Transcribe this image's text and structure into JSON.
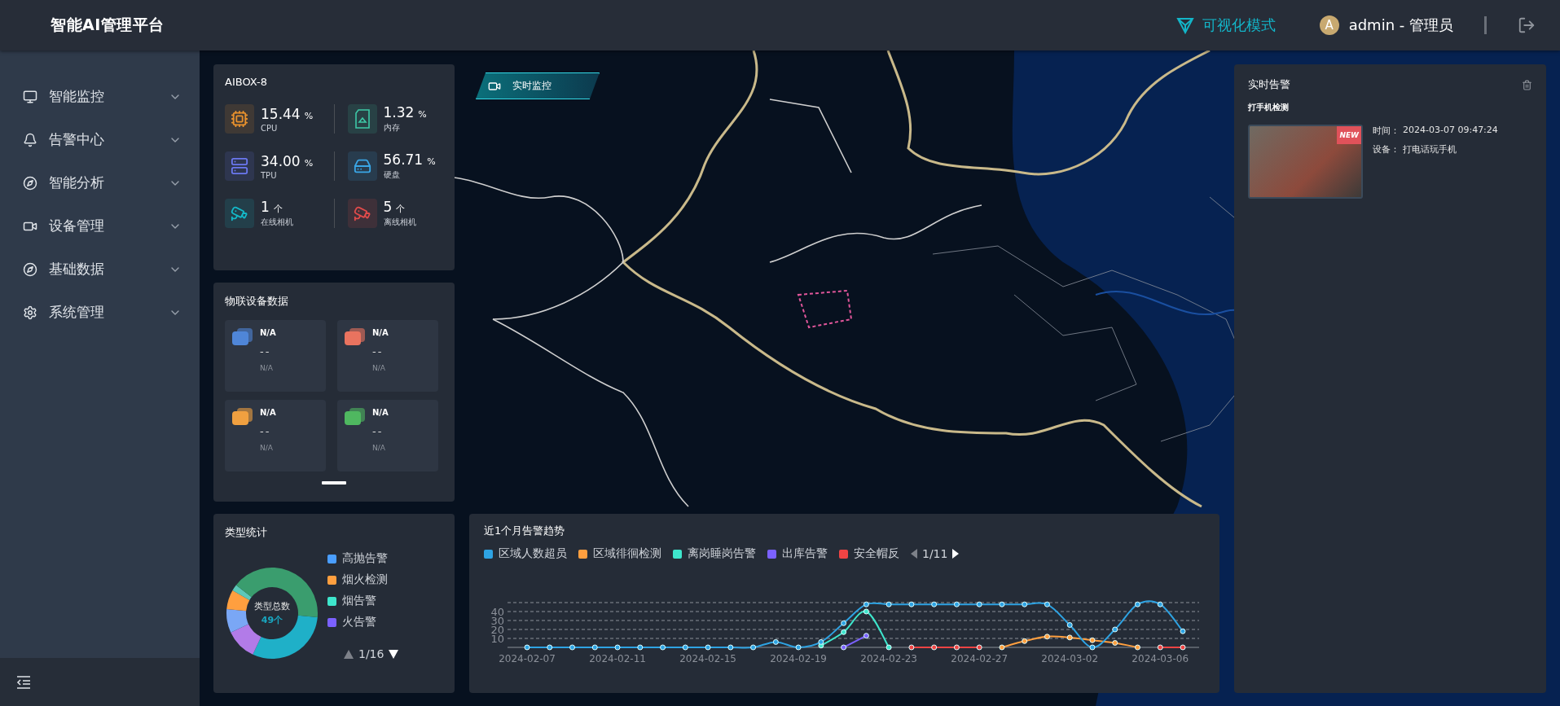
{
  "header": {
    "title": "智能AI管理平台",
    "mode_label": "可视化模式",
    "avatar_letter": "A",
    "user": "admin - 管理员"
  },
  "sidebar": {
    "items": [
      {
        "label": "智能监控",
        "expanded": false
      },
      {
        "label": "告警中心",
        "expanded": false
      },
      {
        "label": "智能分析",
        "expanded": false
      },
      {
        "label": "设备管理",
        "expanded": false
      },
      {
        "label": "基础数据",
        "expanded": false
      },
      {
        "label": "系统管理",
        "expanded": false
      }
    ]
  },
  "map_badge": "实时监控",
  "device": {
    "title": "AIBOX-8",
    "metrics": [
      {
        "value": "15.44",
        "unit": "%",
        "label": "CPU",
        "color": "#e8912d"
      },
      {
        "value": "1.32",
        "unit": "%",
        "label": "内存",
        "color": "#3ec9a7"
      },
      {
        "value": "34.00",
        "unit": "%",
        "label": "TPU",
        "color": "#6b78f0"
      },
      {
        "value": "56.71",
        "unit": "%",
        "label": "硬盘",
        "color": "#3aa6e6"
      },
      {
        "value": "1",
        "unit": "个",
        "label": "在线相机",
        "color": "#14b8c8"
      },
      {
        "value": "5",
        "unit": "个",
        "label": "离线相机",
        "color": "#e04b4b"
      }
    ]
  },
  "iot": {
    "title": "物联设备数据",
    "tiles": [
      {
        "name": "N/A",
        "value": "--",
        "sub": "N/A",
        "color": "#4f86d8"
      },
      {
        "name": "N/A",
        "value": "--",
        "sub": "N/A",
        "color": "#e9735f"
      },
      {
        "name": "N/A",
        "value": "--",
        "sub": "N/A",
        "color": "#f0a040"
      },
      {
        "name": "N/A",
        "value": "--",
        "sub": "N/A",
        "color": "#4fb860"
      }
    ]
  },
  "type_stats": {
    "title": "类型统计",
    "center_label": "类型总数",
    "center_value": "49个",
    "legend": [
      {
        "label": "高抛告警",
        "color": "#4a9eff"
      },
      {
        "label": "烟火检测",
        "color": "#ff9f3f"
      },
      {
        "label": "烟告警",
        "color": "#3ee6cc"
      },
      {
        "label": "火告警",
        "color": "#7b61ff"
      }
    ],
    "page": "1/16",
    "prev_disabled": true,
    "next_disabled": false
  },
  "trend": {
    "title": "近1个月告警趋势",
    "page": "1/11",
    "prev_disabled": true,
    "next_disabled": false,
    "chart_data": {
      "type": "line",
      "grid": true,
      "categories": [
        "2024-02-07",
        null,
        null,
        null,
        "2024-02-11",
        null,
        null,
        null,
        "2024-02-15",
        null,
        null,
        null,
        "2024-02-19",
        null,
        null,
        null,
        "2024-02-23",
        null,
        null,
        null,
        "2024-02-27",
        null,
        null,
        null,
        "2024-03-02",
        null,
        null,
        null,
        "2024-03-06",
        null
      ],
      "ylim": [
        0,
        50
      ],
      "yticks": [
        10,
        20,
        30,
        40
      ],
      "series": [
        {
          "name": "区域人数超员",
          "color": "#2ea3e3",
          "marker": "circle",
          "values": [
            0,
            0,
            0,
            0,
            0,
            0,
            0,
            0,
            0,
            0,
            0,
            6,
            0,
            6,
            27,
            48,
            48,
            48,
            48,
            48,
            48,
            48,
            48,
            48,
            25,
            0,
            20,
            48,
            48,
            18
          ]
        },
        {
          "name": "区域徘徊检测",
          "color": "#ff9f3f",
          "marker": "circle",
          "values": [
            null,
            null,
            null,
            null,
            null,
            null,
            null,
            null,
            null,
            null,
            null,
            null,
            null,
            null,
            null,
            null,
            null,
            null,
            null,
            null,
            null,
            0,
            7,
            12,
            11,
            8,
            5,
            0,
            null,
            null
          ]
        },
        {
          "name": "离岗睡岗告警",
          "color": "#3ee6cc",
          "marker": "circle",
          "values": [
            null,
            null,
            null,
            null,
            null,
            null,
            null,
            null,
            null,
            null,
            null,
            null,
            null,
            2,
            17,
            40,
            0,
            null,
            null,
            null,
            null,
            null,
            null,
            null,
            null,
            null,
            null,
            null,
            null,
            null
          ]
        },
        {
          "name": "出库告警",
          "color": "#7b61ff",
          "marker": "circle",
          "values": [
            null,
            null,
            null,
            null,
            null,
            null,
            null,
            null,
            null,
            null,
            null,
            null,
            null,
            null,
            0,
            13,
            null,
            null,
            null,
            null,
            null,
            null,
            null,
            null,
            null,
            null,
            null,
            null,
            null,
            null
          ]
        },
        {
          "name": "安全帽反",
          "color": "#ef4444",
          "marker": "circle",
          "values": [
            null,
            null,
            null,
            null,
            null,
            null,
            null,
            null,
            null,
            null,
            null,
            null,
            null,
            null,
            null,
            null,
            null,
            0,
            0,
            0,
            0,
            null,
            null,
            null,
            null,
            null,
            null,
            null,
            0,
            0
          ]
        }
      ]
    }
  },
  "alarm": {
    "title": "实时告警",
    "items": [
      {
        "type": "打手机检测",
        "badge": "NEW",
        "time_label": "时间：",
        "time": "2024-03-07 09:47:24",
        "device_label": "设备：",
        "device": "打电话玩手机"
      }
    ]
  }
}
